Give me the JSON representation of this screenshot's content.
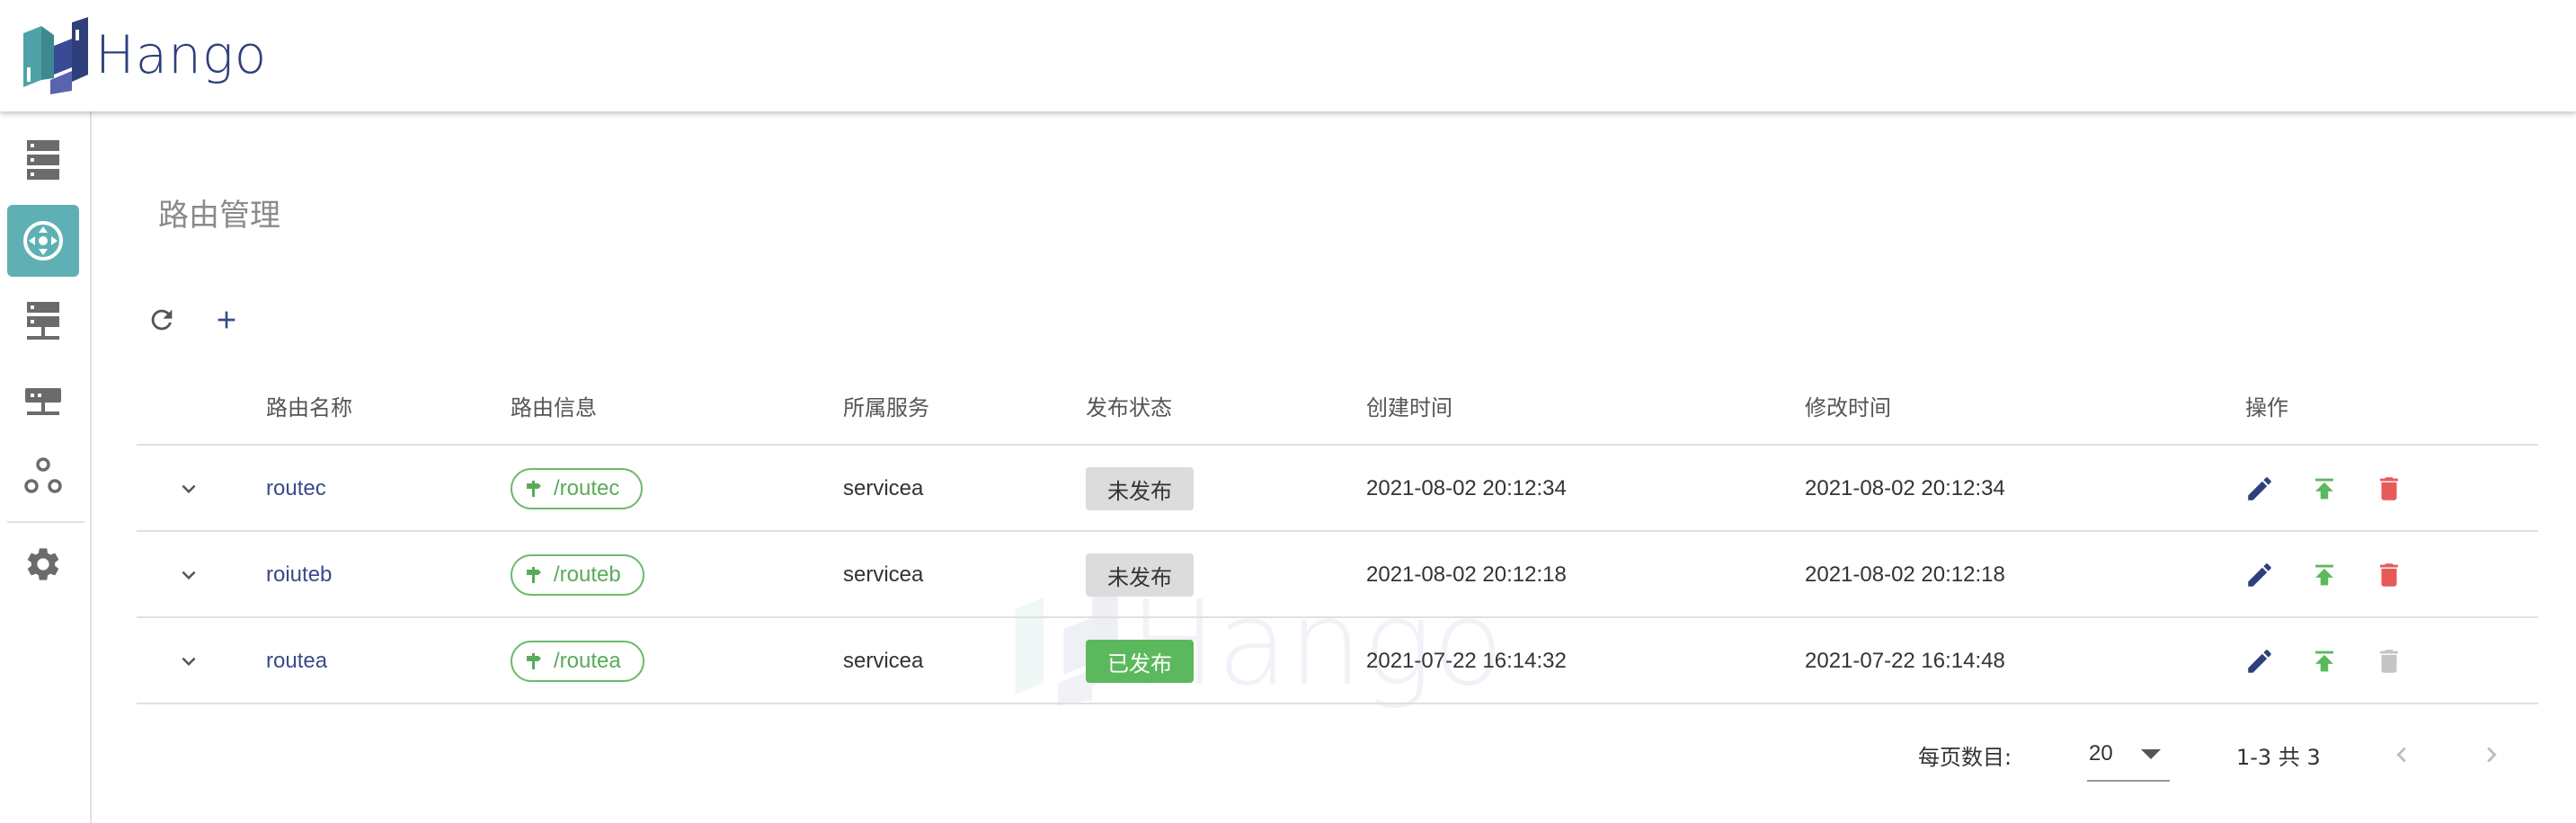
{
  "app": {
    "name": "Hango"
  },
  "sidebar": {
    "items": [
      {
        "id": "gateway",
        "icon": "server-list-icon",
        "active": false
      },
      {
        "id": "routes",
        "icon": "route-hub-icon",
        "active": true
      },
      {
        "id": "services",
        "icon": "service-stack-icon",
        "active": false
      },
      {
        "id": "network",
        "icon": "network-node-icon",
        "active": false
      },
      {
        "id": "topology",
        "icon": "topology-icon",
        "active": false
      },
      {
        "id": "settings",
        "icon": "gear-icon",
        "active": false
      }
    ]
  },
  "page": {
    "title": "路由管理"
  },
  "toolbar": {
    "refresh_icon": "refresh-icon",
    "add_icon": "plus-icon"
  },
  "table": {
    "headers": {
      "name": "路由名称",
      "info": "路由信息",
      "service": "所属服务",
      "status": "发布状态",
      "created": "创建时间",
      "modified": "修改时间",
      "ops": "操作"
    },
    "rows": [
      {
        "name": "routec",
        "path": "/routec",
        "service": "servicea",
        "status": "未发布",
        "published": false,
        "created": "2021-08-02 20:12:34",
        "modified": "2021-08-02 20:12:34"
      },
      {
        "name": "roiuteb",
        "path": "/routeb",
        "service": "servicea",
        "status": "未发布",
        "published": false,
        "created": "2021-08-02 20:12:18",
        "modified": "2021-08-02 20:12:18"
      },
      {
        "name": "routea",
        "path": "/routea",
        "service": "servicea",
        "status": "已发布",
        "published": true,
        "created": "2021-07-22 16:14:32",
        "modified": "2021-07-22 16:14:48"
      }
    ]
  },
  "pagination": {
    "per_page_label": "每页数目:",
    "per_page_value": "20",
    "range_text": "1-3 共 3"
  },
  "colors": {
    "accent": "#5fb0b5",
    "brand": "#2e3f7c",
    "published": "#5cb85c",
    "unpublished": "#dcdcdc",
    "edit": "#2e3f7c",
    "publish_action": "#5cb85c",
    "delete": "#e85a5a",
    "delete_disabled": "#c4c4c4"
  }
}
